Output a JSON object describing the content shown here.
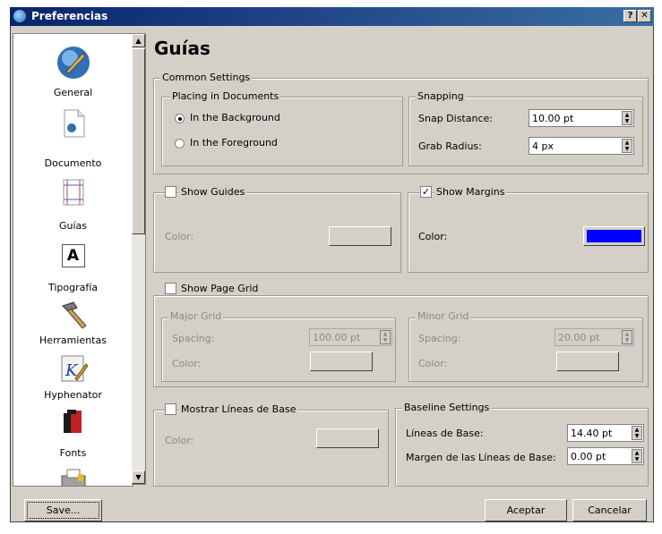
{
  "window": {
    "title": "Preferencias",
    "help_label": "?",
    "close_label": "✕"
  },
  "sidebar": {
    "items": [
      {
        "label": "General",
        "icon": "general-icon"
      },
      {
        "label": "Documento",
        "icon": "document-icon"
      },
      {
        "label": "Guías",
        "icon": "guides-icon"
      },
      {
        "label": "Tipografía",
        "icon": "typography-icon",
        "glyph": "A"
      },
      {
        "label": "Herramientas",
        "icon": "hammer-icon"
      },
      {
        "label": "Hyphenator",
        "icon": "hyphenator-icon"
      },
      {
        "label": "Fonts",
        "icon": "fonts-icon"
      }
    ]
  },
  "page": {
    "title": "Guías"
  },
  "common_settings": {
    "legend": "Common Settings",
    "placing": {
      "legend": "Placing in Documents",
      "background_label": "In the Background",
      "foreground_label": "In the Foreground",
      "selected": "background"
    },
    "snapping": {
      "legend": "Snapping",
      "snap_distance_label": "Snap Distance:",
      "snap_distance_value": "10.00 pt",
      "grab_radius_label": "Grab Radius:",
      "grab_radius_value": "4 px"
    }
  },
  "show_guides": {
    "label": "Show Guides",
    "checked": false,
    "color_label": "Color:"
  },
  "show_margins": {
    "label": "Show Margins",
    "checked": true,
    "color_label": "Color:",
    "color": "#0000ff"
  },
  "page_grid": {
    "label": "Show Page Grid",
    "checked": false,
    "major": {
      "legend": "Major Grid",
      "spacing_label": "Spacing:",
      "spacing_value": "100.00 pt",
      "color_label": "Color:"
    },
    "minor": {
      "legend": "Minor Grid",
      "spacing_label": "Spacing:",
      "spacing_value": "20.00 pt",
      "color_label": "Color:"
    }
  },
  "baseline": {
    "label": "Mostrar Líneas de Base",
    "checked": false,
    "color_label": "Color:",
    "settings": {
      "legend": "Baseline Settings",
      "lines_label": "Líneas de Base:",
      "lines_value": "14.40 pt",
      "margin_label": "Margen de las Líneas de Base:",
      "margin_value": "0.00 pt"
    }
  },
  "buttons": {
    "save": "Save...",
    "accept": "Aceptar",
    "cancel": "Cancelar"
  },
  "colors": {
    "titlebar": "#0a246a",
    "dialog": "#d4d0c8",
    "margin_swatch": "#0000ff"
  }
}
